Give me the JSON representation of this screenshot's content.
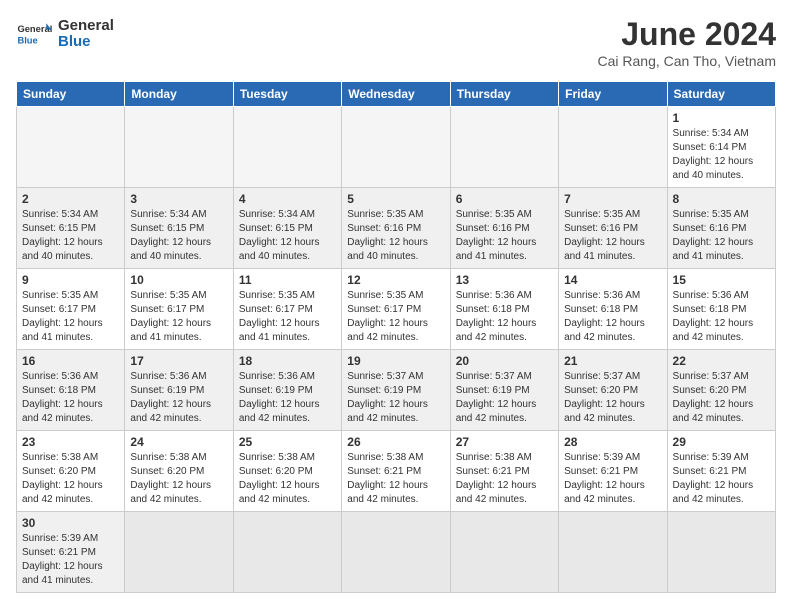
{
  "header": {
    "logo_text_general": "General",
    "logo_text_blue": "Blue",
    "month_title": "June 2024",
    "location": "Cai Rang, Can Tho, Vietnam"
  },
  "days_of_week": [
    "Sunday",
    "Monday",
    "Tuesday",
    "Wednesday",
    "Thursday",
    "Friday",
    "Saturday"
  ],
  "weeks": [
    [
      {
        "day": "",
        "info": ""
      },
      {
        "day": "",
        "info": ""
      },
      {
        "day": "",
        "info": ""
      },
      {
        "day": "",
        "info": ""
      },
      {
        "day": "",
        "info": ""
      },
      {
        "day": "",
        "info": ""
      },
      {
        "day": "1",
        "info": "Sunrise: 5:34 AM\nSunset: 6:14 PM\nDaylight: 12 hours and 40 minutes."
      }
    ],
    [
      {
        "day": "2",
        "info": "Sunrise: 5:34 AM\nSunset: 6:15 PM\nDaylight: 12 hours and 40 minutes."
      },
      {
        "day": "3",
        "info": "Sunrise: 5:34 AM\nSunset: 6:15 PM\nDaylight: 12 hours and 40 minutes."
      },
      {
        "day": "4",
        "info": "Sunrise: 5:34 AM\nSunset: 6:15 PM\nDaylight: 12 hours and 40 minutes."
      },
      {
        "day": "5",
        "info": "Sunrise: 5:35 AM\nSunset: 6:16 PM\nDaylight: 12 hours and 40 minutes."
      },
      {
        "day": "6",
        "info": "Sunrise: 5:35 AM\nSunset: 6:16 PM\nDaylight: 12 hours and 41 minutes."
      },
      {
        "day": "7",
        "info": "Sunrise: 5:35 AM\nSunset: 6:16 PM\nDaylight: 12 hours and 41 minutes."
      },
      {
        "day": "8",
        "info": "Sunrise: 5:35 AM\nSunset: 6:16 PM\nDaylight: 12 hours and 41 minutes."
      }
    ],
    [
      {
        "day": "9",
        "info": "Sunrise: 5:35 AM\nSunset: 6:17 PM\nDaylight: 12 hours and 41 minutes."
      },
      {
        "day": "10",
        "info": "Sunrise: 5:35 AM\nSunset: 6:17 PM\nDaylight: 12 hours and 41 minutes."
      },
      {
        "day": "11",
        "info": "Sunrise: 5:35 AM\nSunset: 6:17 PM\nDaylight: 12 hours and 41 minutes."
      },
      {
        "day": "12",
        "info": "Sunrise: 5:35 AM\nSunset: 6:17 PM\nDaylight: 12 hours and 42 minutes."
      },
      {
        "day": "13",
        "info": "Sunrise: 5:36 AM\nSunset: 6:18 PM\nDaylight: 12 hours and 42 minutes."
      },
      {
        "day": "14",
        "info": "Sunrise: 5:36 AM\nSunset: 6:18 PM\nDaylight: 12 hours and 42 minutes."
      },
      {
        "day": "15",
        "info": "Sunrise: 5:36 AM\nSunset: 6:18 PM\nDaylight: 12 hours and 42 minutes."
      }
    ],
    [
      {
        "day": "16",
        "info": "Sunrise: 5:36 AM\nSunset: 6:18 PM\nDaylight: 12 hours and 42 minutes."
      },
      {
        "day": "17",
        "info": "Sunrise: 5:36 AM\nSunset: 6:19 PM\nDaylight: 12 hours and 42 minutes."
      },
      {
        "day": "18",
        "info": "Sunrise: 5:36 AM\nSunset: 6:19 PM\nDaylight: 12 hours and 42 minutes."
      },
      {
        "day": "19",
        "info": "Sunrise: 5:37 AM\nSunset: 6:19 PM\nDaylight: 12 hours and 42 minutes."
      },
      {
        "day": "20",
        "info": "Sunrise: 5:37 AM\nSunset: 6:19 PM\nDaylight: 12 hours and 42 minutes."
      },
      {
        "day": "21",
        "info": "Sunrise: 5:37 AM\nSunset: 6:20 PM\nDaylight: 12 hours and 42 minutes."
      },
      {
        "day": "22",
        "info": "Sunrise: 5:37 AM\nSunset: 6:20 PM\nDaylight: 12 hours and 42 minutes."
      }
    ],
    [
      {
        "day": "23",
        "info": "Sunrise: 5:38 AM\nSunset: 6:20 PM\nDaylight: 12 hours and 42 minutes."
      },
      {
        "day": "24",
        "info": "Sunrise: 5:38 AM\nSunset: 6:20 PM\nDaylight: 12 hours and 42 minutes."
      },
      {
        "day": "25",
        "info": "Sunrise: 5:38 AM\nSunset: 6:20 PM\nDaylight: 12 hours and 42 minutes."
      },
      {
        "day": "26",
        "info": "Sunrise: 5:38 AM\nSunset: 6:21 PM\nDaylight: 12 hours and 42 minutes."
      },
      {
        "day": "27",
        "info": "Sunrise: 5:38 AM\nSunset: 6:21 PM\nDaylight: 12 hours and 42 minutes."
      },
      {
        "day": "28",
        "info": "Sunrise: 5:39 AM\nSunset: 6:21 PM\nDaylight: 12 hours and 42 minutes."
      },
      {
        "day": "29",
        "info": "Sunrise: 5:39 AM\nSunset: 6:21 PM\nDaylight: 12 hours and 42 minutes."
      }
    ],
    [
      {
        "day": "30",
        "info": "Sunrise: 5:39 AM\nSunset: 6:21 PM\nDaylight: 12 hours and 41 minutes."
      },
      {
        "day": "",
        "info": ""
      },
      {
        "day": "",
        "info": ""
      },
      {
        "day": "",
        "info": ""
      },
      {
        "day": "",
        "info": ""
      },
      {
        "day": "",
        "info": ""
      },
      {
        "day": "",
        "info": ""
      }
    ]
  ]
}
